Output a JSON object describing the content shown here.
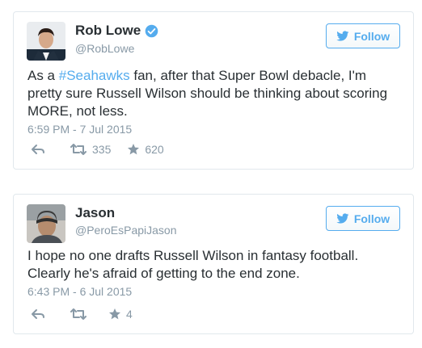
{
  "tweets": [
    {
      "name": "Rob Lowe",
      "handle": "@RobLowe",
      "verified": true,
      "follow_label": "Follow",
      "text_pre": "As a ",
      "hashtag": "#Seahawks",
      "text_post": " fan, after that Super Bowl debacle, I'm pretty sure Russell Wilson should be thinking about scoring MORE, not less.",
      "timestamp": "6:59 PM - 7 Jul 2015",
      "retweets": "335",
      "favorites": "620"
    },
    {
      "name": "Jason",
      "handle": "@PeroEsPapiJason",
      "verified": false,
      "follow_label": "Follow",
      "text": "I hope no one drafts Russell Wilson in fantasy football. Clearly he's afraid of getting to the end zone.",
      "timestamp": "6:43 PM - 6 Jul 2015",
      "retweets": "",
      "favorites": "4"
    }
  ],
  "colors": {
    "accent": "#55acee",
    "muted": "#8899a6",
    "text": "#292f33",
    "border": "#e1e8ed"
  },
  "icons": [
    "verified-badge-icon",
    "twitter-bird-icon",
    "reply-icon",
    "retweet-icon",
    "star-icon"
  ]
}
